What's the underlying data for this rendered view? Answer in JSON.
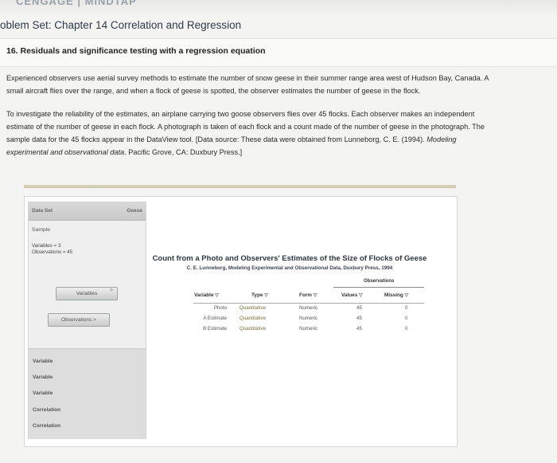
{
  "brand": {
    "text": "CENGAGE | MINDTAP"
  },
  "problem_set_title": "oblem Set: Chapter 14 Correlation and Regression",
  "section_title": "16. Residuals and significance testing with a regression equation",
  "paragraphs": {
    "p1_line1": "Experienced observers use aerial survey methods to estimate the number of snow geese in their summer range area west of Hudson Bay, Canada. A",
    "p1_line2": "small aircraft flies over the range, and when a flock of geese is spotted, the observer estimates the number of geese in the flock.",
    "p2_line1": "To investigate the reliability of the estimates, an airplane carrying two goose observers flies over 45 flocks. Each observer makes an independent",
    "p2_line2": "estimate of the number of geese in each flock. A photograph is taken of each flock and a count made of the number of geese in the photograph. The",
    "p2_line3": "sample data for the 45 flocks appear in the DataView tool. [Data source: These data were obtained from Lunneborg, C. E. (1994). ",
    "p2_line3_italic": "Modeling",
    "p2_line4_italic": "experimental and observational data",
    "p2_line4": ". Pacific Grove, CA: Duxbury Press.]"
  },
  "dataview": {
    "tab_dataset": "Data Set",
    "tab_name": "Geese",
    "sample_label": "Sample",
    "variables_info": "Variables = 3",
    "observations_info": "Observations = 45",
    "variables_button": "Variables",
    "observations_button": "Observations",
    "arrow": ">",
    "lower_items": [
      "Variable",
      "Variable",
      "Variable",
      "Correlation",
      "Correlation"
    ],
    "table_title": "Count from a Photo and Observers' Estimates of the Size of Flocks of Geese",
    "table_subtitle": "C. E. Lunneborg, Modeling Experimental and Observational Data, Duxbury Press, 1994",
    "observations_group": "Observations",
    "columns": {
      "variable": "Variable",
      "type": "Type",
      "form": "Form",
      "values": "Values",
      "missing": "Missing"
    },
    "sort_glyph": "▽",
    "rows": [
      {
        "variable": "Photo",
        "type": "Quantitative",
        "form": "Numeric",
        "values": "45",
        "missing": "0"
      },
      {
        "variable": "A Estimate",
        "type": "Quantitative",
        "form": "Numeric",
        "values": "45",
        "missing": "0"
      },
      {
        "variable": "B Estimate",
        "type": "Quantitative",
        "form": "Numeric",
        "values": "45",
        "missing": "0"
      }
    ]
  }
}
